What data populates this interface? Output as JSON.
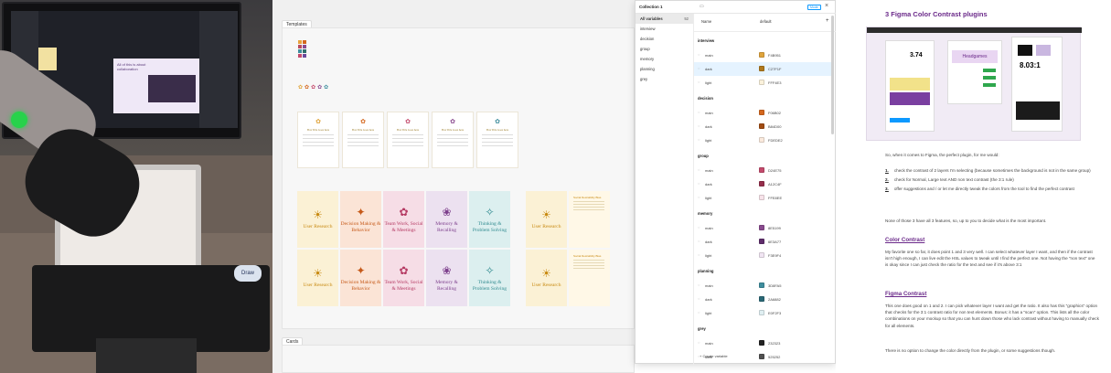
{
  "colors": {
    "canvas_bg": "#f0f0f0",
    "accent_blue": "#0d99ff",
    "article_heading": "#6b2a8a",
    "highlight_row": "#e5f3ff"
  },
  "photo": {
    "sticker_text": "Draw",
    "screen_slide_text": "All of this is about collaboration"
  },
  "canvas": {
    "templates_label": "Templates",
    "cards_label": "Cards",
    "swatches": [
      "#e8a33d",
      "#d4671e",
      "#b94a5c",
      "#8a4a8f",
      "#3f8e9e",
      "#2e6f6a",
      "#c44a6c",
      "#6a4a9c"
    ],
    "template_cards": [
      {
        "title": "Box Title Goes here",
        "color": "#e0a43c"
      },
      {
        "title": "Box Title Goes here",
        "color": "#d4671e"
      },
      {
        "title": "Box Title Goes here",
        "color": "#c44a6c"
      },
      {
        "title": "Box Title Goes here",
        "color": "#8a4a8f"
      },
      {
        "title": "Box Title Goes here",
        "color": "#3f8e9e"
      }
    ],
    "category_cards": [
      {
        "title": "User Research",
        "bg": "#fbf1d5",
        "fg": "#c88a12"
      },
      {
        "title": "Decision Making & Behavior",
        "bg": "#fbe4d6",
        "fg": "#c65a1a"
      },
      {
        "title": "Team Work, Social & Meetings",
        "bg": "#f6dde6",
        "fg": "#b53a63"
      },
      {
        "title": "Memory & Recalling",
        "bg": "#ece1f0",
        "fg": "#7d3f8c"
      },
      {
        "title": "Thinking & Problem Solving",
        "bg": "#dcefef",
        "fg": "#2f8a8f"
      }
    ],
    "side_cards": [
      {
        "title": "User Research",
        "sub": "Social Desirability Bias"
      },
      {
        "title": "User Research",
        "sub": "Social Desirability Bias"
      }
    ]
  },
  "variables_panel": {
    "collection_title": "Collection 1",
    "collection_button": "Mode",
    "left_items": [
      {
        "label": "All variables",
        "count": "52",
        "selected": true
      },
      {
        "label": "interview",
        "count": "",
        "selected": false
      },
      {
        "label": "decision",
        "count": "",
        "selected": false
      },
      {
        "label": "group",
        "count": "",
        "selected": false
      },
      {
        "label": "memory",
        "count": "",
        "selected": false
      },
      {
        "label": "planning",
        "count": "",
        "selected": false
      },
      {
        "label": "grey",
        "count": "",
        "selected": false
      }
    ],
    "col_name": "Name",
    "col_default": "default",
    "add_col": "+",
    "groups": [
      {
        "title": "interview",
        "rows": [
          {
            "name": "main",
            "color": "#e0a43c",
            "hex": "F4B951",
            "highlight": false
          },
          {
            "name": "dark",
            "color": "#b0781c",
            "hex": "C27F1F",
            "highlight": true
          },
          {
            "name": "light",
            "color": "#fbf2dc",
            "hex": "FFF4E3",
            "highlight": false
          }
        ]
      },
      {
        "title": "decision",
        "rows": [
          {
            "name": "main",
            "color": "#d4671e",
            "hex": "F06B02",
            "highlight": false
          },
          {
            "name": "dark",
            "color": "#a14c12",
            "hex": "B84D00",
            "highlight": false
          },
          {
            "name": "light",
            "color": "#fbeadd",
            "hex": "FDEDE2",
            "highlight": false
          }
        ]
      },
      {
        "title": "group",
        "rows": [
          {
            "name": "main",
            "color": "#c44a6c",
            "hex": "D24E75",
            "highlight": false
          },
          {
            "name": "dark",
            "color": "#962e4c",
            "hex": "A12C4F",
            "highlight": false
          },
          {
            "name": "light",
            "color": "#f8e3ea",
            "hex": "FFE8EE",
            "highlight": false
          }
        ]
      },
      {
        "title": "memory",
        "rows": [
          {
            "name": "main",
            "color": "#8a4a8f",
            "hex": "8E5199",
            "highlight": false
          },
          {
            "name": "dark",
            "color": "#5f2d6b",
            "hex": "6E3A77",
            "highlight": false
          },
          {
            "name": "light",
            "color": "#f1e5f3",
            "hex": "F3E9F4",
            "highlight": false
          }
        ]
      },
      {
        "title": "planning",
        "rows": [
          {
            "name": "main",
            "color": "#3f8e9e",
            "hex": "3D8FA5",
            "highlight": false
          },
          {
            "name": "dark",
            "color": "#2a6876",
            "hex": "2A6882",
            "highlight": false
          },
          {
            "name": "light",
            "color": "#e0eff2",
            "hex": "E0F2F3",
            "highlight": false
          }
        ]
      },
      {
        "title": "grey",
        "rows": [
          {
            "name": "main",
            "color": "#232323",
            "hex": "232323",
            "highlight": false
          },
          {
            "name": "dark",
            "color": "#505050",
            "hex": "525252",
            "highlight": false
          }
        ]
      }
    ],
    "create_label": "Create variable"
  },
  "article": {
    "title": "3 Figma Color Contrast plugins",
    "shot_big_number": "3.74",
    "shot_ratio": "8.03:1",
    "shot_word": "Headgames",
    "intro": "So, when it comes to Figma, the perfect plugin, for me would:",
    "list": [
      {
        "num": "1.",
        "text": "check the contrast of 2 layers I'm selecting (because sometimes the background is not in the same group)"
      },
      {
        "num": "2.",
        "text": "check for Normal, Large text AND non text contrast (the 3:1 rule)"
      },
      {
        "num": "3.",
        "text": "offer suggestions and / or let me directly tweak the colors from the tool to find the perfect contrast"
      }
    ],
    "none_text": "None of those 3 have all 3 features, so, up to you to decide what is the most important.",
    "h_color_contrast": "Color Contrast",
    "p_color_contrast": "My favorite one so far, it does point 1 and 3 very well. I can select whatever layer I want, and then if the contrast isn't high enough, I can live edit the HSL values to tweak until I find the perfect one. Not having the \"non text\" one is okay since I can just check the ratio for the text and see if it's above 3:1",
    "h_figma_contrast": "Figma Contrast",
    "p_figma_contrast": "This one does good on 1 and 2. I can pick whatever layer I want and get the ratio. It also has this \"graphics\" option that checks for the 3:1 contrast ratio for non text elements. Bonus: it has a \"scan\" option. This lists all the color combinations on your mockup so that you can hunt down those who lack contrast without having to manually check for all elements.",
    "p_last": "There is no option to change the color directly from the plugin, or some suggestions though."
  }
}
